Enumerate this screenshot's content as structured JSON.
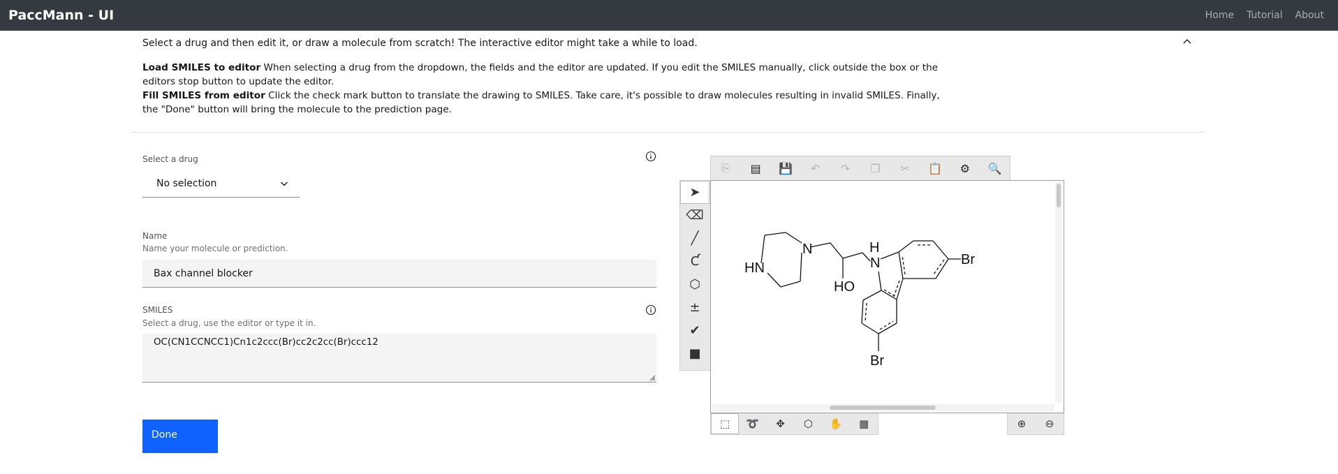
{
  "app": {
    "title": "PaccMann - UI",
    "nav": [
      "Home",
      "Tutorial",
      "About"
    ]
  },
  "intro": {
    "text": "Select a drug and then edit it, or draw a molecule from scratch! The interactive editor might take a while to load.",
    "help_load_title": "Load SMILES to editor",
    "help_load_text": " When selecting a drug from the dropdown, the fields and the editor are updated. If you edit the SMILES manually, click outside the box or the editors stop button to update the editor.",
    "help_fill_title": "Fill SMILES from editor",
    "help_fill_text": " Click the check mark button to translate the drawing to SMILES. Take care, it's possible to draw molecules resulting in invalid SMILES. Finally, the \"Done\" button will bring the molecule to the prediction page."
  },
  "form": {
    "drug_label": "Select a drug",
    "drug_selected": "No selection",
    "name_label": "Name",
    "name_helper": "Name your molecule or prediction.",
    "name_value": "Bax channel blocker",
    "smiles_label": "SMILES",
    "smiles_helper": "Select a drug, use the editor or type it in.",
    "smiles_value": "OC(CN1CCNCC1)Cn1c2ccc(Br)cc2c2cc(Br)ccc12",
    "done_label": "Done"
  },
  "editor": {
    "atoms": {
      "hn": "HN",
      "n1": "N",
      "h": "H",
      "n2": "N",
      "ho": "HO",
      "br1": "Br",
      "br2": "Br"
    }
  },
  "colors": {
    "topbar": "#343a40",
    "primary": "#0f62fe",
    "field_bg": "#f4f4f4"
  }
}
